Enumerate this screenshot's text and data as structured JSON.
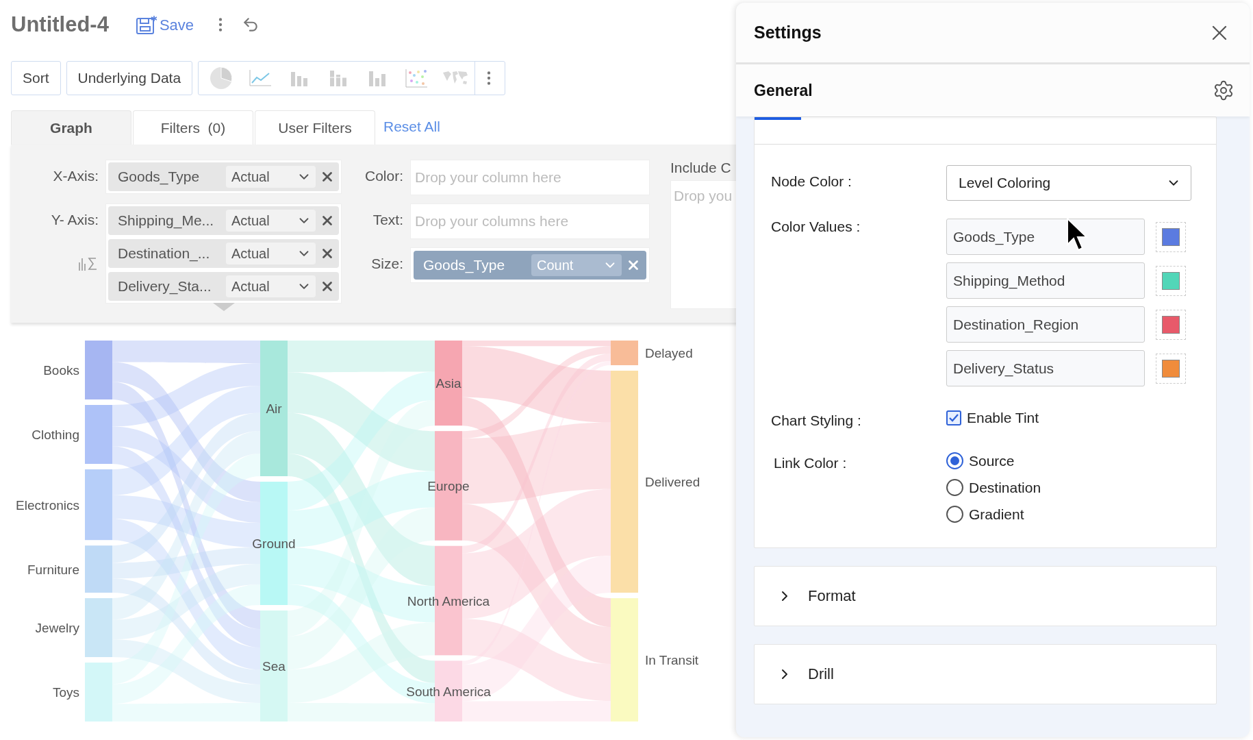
{
  "document": {
    "title": "Untitled-4",
    "save_label": "Save"
  },
  "toolbar": {
    "buttons": [
      {
        "label": "Sort"
      },
      {
        "label": "Underlying Data"
      }
    ],
    "chart_types": [
      {
        "kind": "pie"
      },
      {
        "kind": "line"
      },
      {
        "kind": "bar"
      },
      {
        "kind": "stacked_bar"
      },
      {
        "kind": "range_bar"
      },
      {
        "kind": "scatter"
      },
      {
        "kind": "map"
      }
    ]
  },
  "tabs": [
    {
      "label": "Graph",
      "selected": true
    },
    {
      "label": "Filters  (0)",
      "selected": false
    },
    {
      "label": "User Filters",
      "selected": false
    }
  ],
  "reset_link": "Reset All",
  "shelves": {
    "x_axis": {
      "label": "X-Axis:",
      "fields": [
        {
          "name": "Goods_Type",
          "aggregate": "Actual"
        }
      ]
    },
    "y_axis": {
      "label": "Y- Axis:",
      "fields": [
        {
          "name": "Shipping_Me...",
          "aggregate": "Actual"
        },
        {
          "name": "Destination_...",
          "aggregate": "Actual"
        },
        {
          "name": "Delivery_Sta...",
          "aggregate": "Actual"
        }
      ]
    },
    "color": {
      "label": "Color:",
      "placeholder": "Drop your column here"
    },
    "text": {
      "label": "Text:",
      "placeholder": "Drop your columns here"
    },
    "size": {
      "label": "Size:",
      "fields": [
        {
          "name": "Goods_Type",
          "aggregate": "Count"
        }
      ]
    },
    "include": {
      "label": "Include C",
      "placeholder": "Drop you"
    }
  },
  "sankey": {
    "columns": [
      [
        {
          "label": "Books",
          "color": "#a6b6f2"
        },
        {
          "label": "Clothing",
          "color": "#aec2f8"
        },
        {
          "label": "Electronics",
          "color": "#b6cef9"
        },
        {
          "label": "Furniture",
          "color": "#bfdaf6"
        },
        {
          "label": "Jewelry",
          "color": "#c9e6f6"
        },
        {
          "label": "Toys",
          "color": "#d3f7f8"
        }
      ],
      [
        {
          "label": "Air",
          "color": "#a8e8dc"
        },
        {
          "label": "Ground",
          "color": "#b8f8f5"
        },
        {
          "label": "Sea",
          "color": "#d5f8f3"
        }
      ],
      [
        {
          "label": "Asia",
          "color": "#f6a6b1"
        },
        {
          "label": "Europe",
          "color": "#f8b6c1"
        },
        {
          "label": "North America",
          "color": "#fac4cf"
        },
        {
          "label": "South America",
          "color": "#fcd9e5"
        }
      ],
      [
        {
          "label": "Delayed",
          "color": "#f8bc98"
        },
        {
          "label": "Delivered",
          "color": "#fbdfa8"
        },
        {
          "label": "In Transit",
          "color": "#fafac0"
        }
      ]
    ]
  },
  "settings": {
    "title": "Settings",
    "section": "General",
    "node_color": {
      "label": "Node Color :",
      "value": "Level Coloring"
    },
    "color_values": {
      "label": "Color Values :",
      "items": [
        {
          "value": "Goods_Type",
          "color": "#5b7be0"
        },
        {
          "value": "Shipping_Method",
          "color": "#52d6b8"
        },
        {
          "value": "Destination_Region",
          "color": "#e85a6a"
        },
        {
          "value": "Delivery_Status",
          "color": "#f08c3c"
        }
      ]
    },
    "chart_styling": {
      "label": "Chart Styling :",
      "option": "Enable Tint",
      "checked": true
    },
    "link_color": {
      "label": "Link Color :",
      "options": [
        {
          "label": "Source",
          "selected": true
        },
        {
          "label": "Destination",
          "selected": false
        },
        {
          "label": "Gradient",
          "selected": false
        }
      ]
    },
    "panels": [
      {
        "label": "Format",
        "expanded": false
      },
      {
        "label": "Drill",
        "expanded": false
      }
    ]
  }
}
